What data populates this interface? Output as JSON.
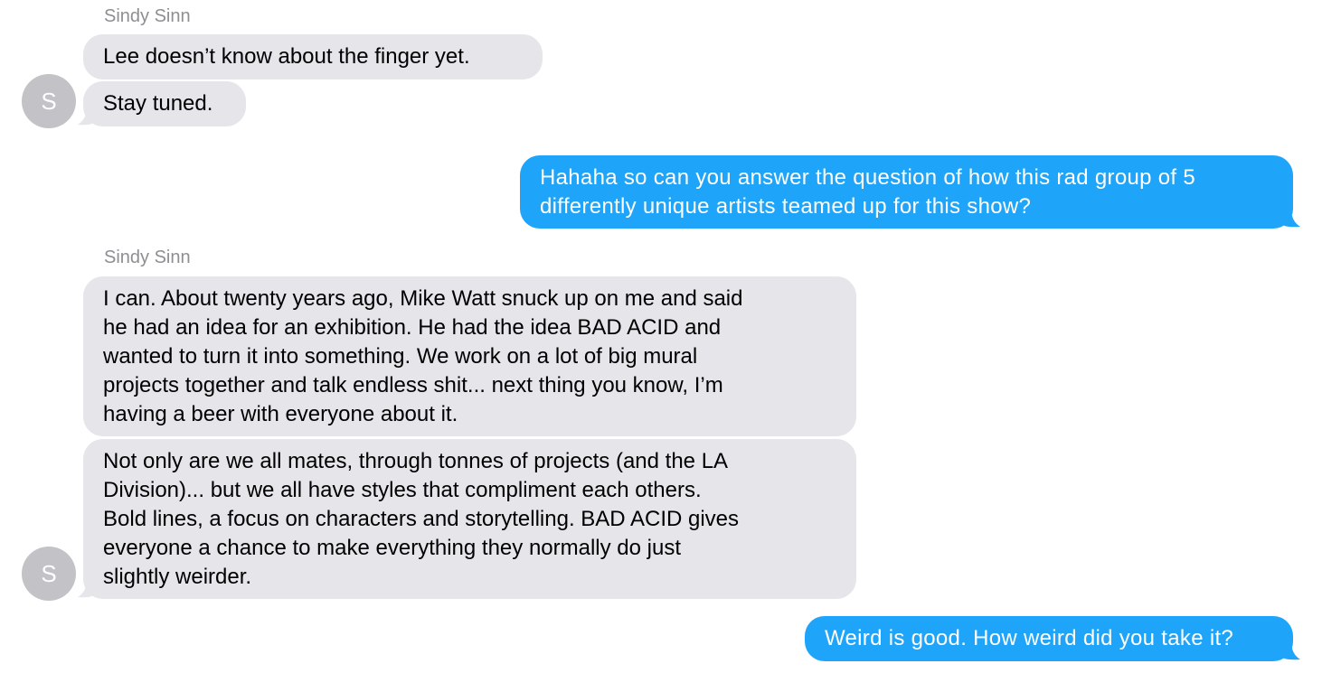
{
  "thread": {
    "sender_name_1": "Sindy Sinn",
    "sender_name_2": "Sindy Sinn",
    "avatar_initial_1": "S",
    "avatar_initial_2": "S",
    "colors": {
      "incoming_bubble": "#e5e5ea",
      "outgoing_bubble": "#1ea4f8",
      "avatar": "#c2c2c7",
      "sender_label": "#8e8e93"
    },
    "messages": [
      {
        "direction": "incoming",
        "lines": [
          "Lee doesn’t know about the finger yet."
        ]
      },
      {
        "direction": "incoming",
        "lines": [
          "Stay tuned."
        ]
      },
      {
        "direction": "outgoing",
        "lines": [
          "Hahaha so can you answer the question of how this rad group of 5",
          "differently unique artists teamed up for this show?"
        ]
      },
      {
        "direction": "incoming",
        "lines": [
          "I can. About twenty years ago, Mike Watt snuck up on me and said",
          "he had an idea for an exhibition. He had the idea BAD ACID and",
          "wanted to turn it into something. We work on a lot of big mural",
          "projects together and talk endless shit... next thing you know, I’m",
          "having a beer with everyone about it."
        ]
      },
      {
        "direction": "incoming",
        "lines": [
          "Not only are we all mates, through tonnes of projects (and the LA",
          "Division)... but we all have styles that compliment each others.",
          "Bold lines, a focus on characters and storytelling. BAD ACID gives",
          "everyone a chance to make everything they normally do just",
          "slightly weirder."
        ]
      },
      {
        "direction": "outgoing",
        "lines": [
          "Weird is good. How weird did you take it?"
        ]
      }
    ]
  }
}
